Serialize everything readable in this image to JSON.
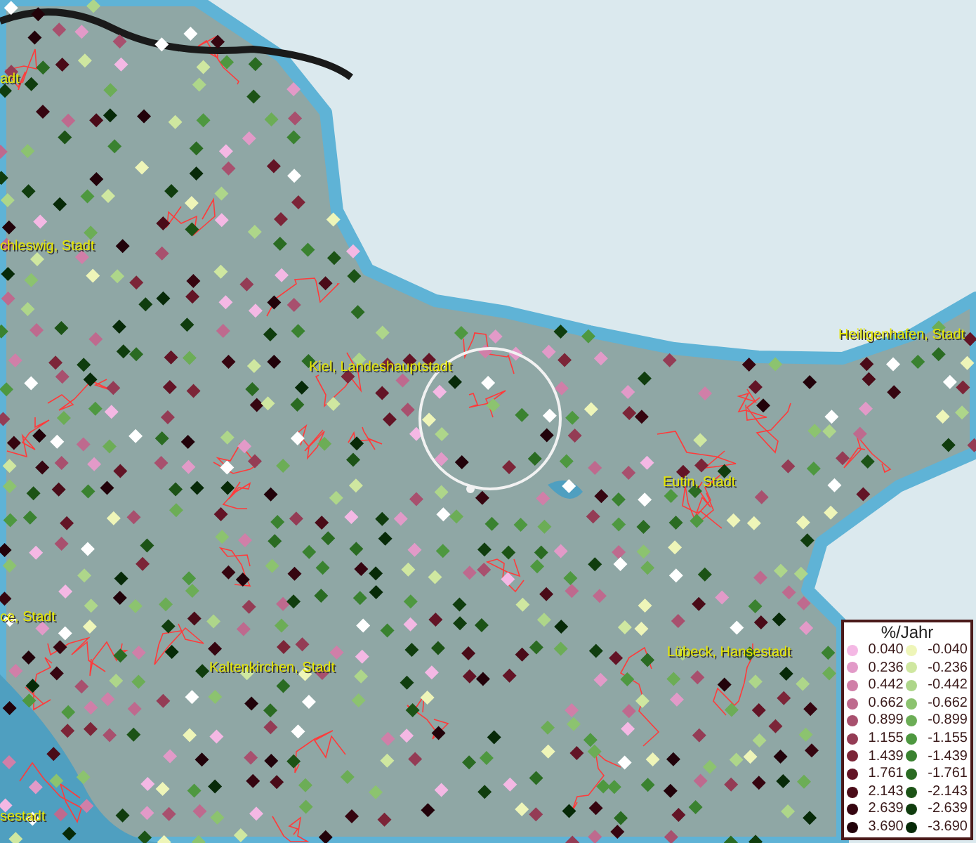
{
  "map": {
    "labels": [
      {
        "text": "adt"
      },
      {
        "text": "chleswig, Stadt"
      },
      {
        "text": "Kiel, Landeshauptstadt"
      },
      {
        "text": "Heiligenhafen, Stadt"
      },
      {
        "text": "Eutin, Stadt"
      },
      {
        "text": "ce, Stadt"
      },
      {
        "text": "Lübeck, Hansestadt"
      },
      {
        "text": "Kaltenkirchen, Stadt"
      },
      {
        "text": "sestadt"
      }
    ]
  },
  "legend": {
    "title": "%/Jahr",
    "items": [
      {
        "label": "0.040",
        "color": "#f4b8e4"
      },
      {
        "label": "-0.040",
        "color": "#eef5b8"
      },
      {
        "label": "0.236",
        "color": "#e29ac8"
      },
      {
        "label": "-0.236",
        "color": "#cfe7a0"
      },
      {
        "label": "0.442",
        "color": "#d07fa8"
      },
      {
        "label": "-0.442",
        "color": "#aed68a"
      },
      {
        "label": "0.662",
        "color": "#be6a8e"
      },
      {
        "label": "-0.662",
        "color": "#8cc36f"
      },
      {
        "label": "0.899",
        "color": "#a8506e"
      },
      {
        "label": "-0.899",
        "color": "#6cad56"
      },
      {
        "label": "1.155",
        "color": "#943c55"
      },
      {
        "label": "-1.155",
        "color": "#4e9840"
      },
      {
        "label": "1.439",
        "color": "#7c2538"
      },
      {
        "label": "-1.439",
        "color": "#3a8230"
      },
      {
        "label": "1.761",
        "color": "#631426"
      },
      {
        "label": "-1.761",
        "color": "#2a6b22"
      },
      {
        "label": "2.143",
        "color": "#4a0b18"
      },
      {
        "label": "-2.143",
        "color": "#1c5316"
      },
      {
        "label": "2.639",
        "color": "#360510"
      },
      {
        "label": "-2.639",
        "color": "#103d0e"
      },
      {
        "label": "3.690",
        "color": "#22020a"
      },
      {
        "label": "-3.690",
        "color": "#072a08"
      }
    ]
  }
}
